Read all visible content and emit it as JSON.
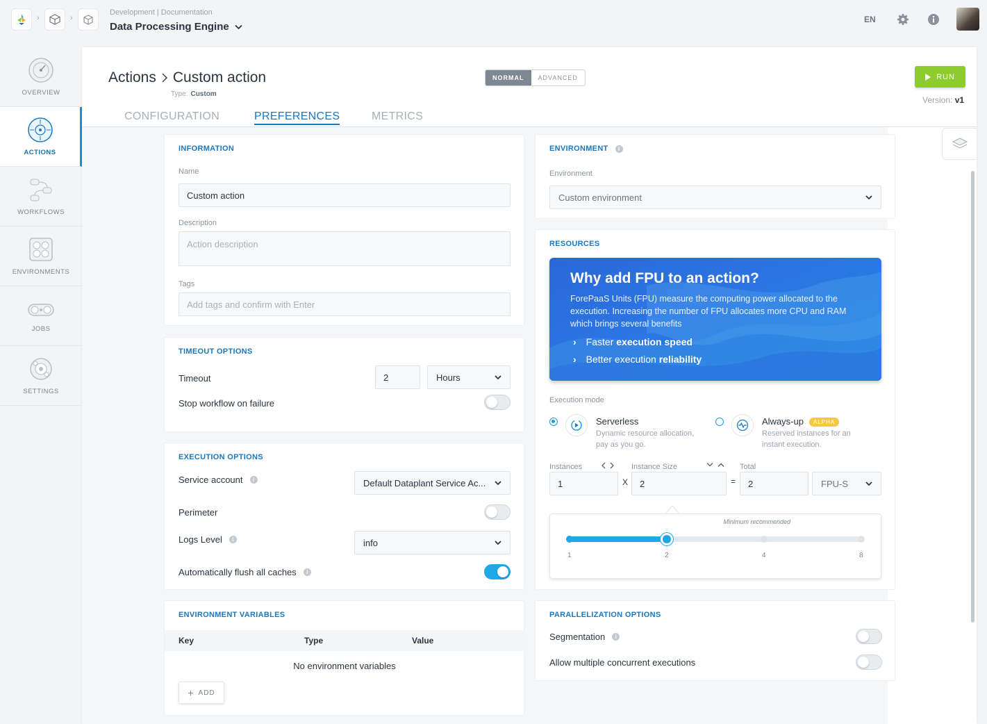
{
  "header": {
    "breadcrumb_small": "Development | Documentation",
    "project_title": "Data Processing Engine",
    "language": "EN"
  },
  "sidebar": {
    "items": [
      {
        "label": "OVERVIEW",
        "icon": "gauge-icon"
      },
      {
        "label": "ACTIONS",
        "icon": "target-icon",
        "active": true
      },
      {
        "label": "WORKFLOWS",
        "icon": "workflow-icon"
      },
      {
        "label": "ENVIRONMENTS",
        "icon": "environment-icon"
      },
      {
        "label": "JOBS",
        "icon": "jobs-icon"
      },
      {
        "label": "SETTINGS",
        "icon": "gear-icon"
      }
    ]
  },
  "page": {
    "title_parent": "Actions",
    "title_current": "Custom action",
    "type_label": "Type:",
    "type_value": "Custom",
    "mode_normal": "NORMAL",
    "mode_advanced": "ADVANCED",
    "run_label": "RUN",
    "version_label": "Version:",
    "version_value": "v1",
    "tabs": [
      "CONFIGURATION",
      "PREFERENCES",
      "METRICS"
    ],
    "active_tab": "PREFERENCES"
  },
  "information": {
    "title": "INFORMATION",
    "name_label": "Name",
    "name_value": "Custom action",
    "description_label": "Description",
    "description_placeholder": "Action description",
    "tags_label": "Tags",
    "tags_placeholder": "Add tags and confirm with Enter"
  },
  "timeout": {
    "title": "TIMEOUT OPTIONS",
    "timeout_label": "Timeout",
    "timeout_value": "2",
    "unit": "Hours",
    "stop_label": "Stop workflow on failure",
    "stop_on": false
  },
  "execution": {
    "title": "EXECUTION OPTIONS",
    "service_account_label": "Service account",
    "service_account_value": "Default Dataplant Service Ac...",
    "perimeter_label": "Perimeter",
    "perimeter_on": false,
    "logs_label": "Logs Level",
    "logs_value": "info",
    "flush_label": "Automatically flush all caches",
    "flush_on": true
  },
  "env_vars": {
    "title": "ENVIRONMENT VARIABLES",
    "columns": [
      "Key",
      "Type",
      "Value"
    ],
    "empty_text": "No environment variables",
    "add_label": "ADD"
  },
  "environment": {
    "title": "ENVIRONMENT",
    "label": "Environment",
    "value": "Custom environment"
  },
  "resources": {
    "title": "RESOURCES",
    "banner_title": "Why add FPU to an action?",
    "banner_text": "ForePaaS Units (FPU) measure the computing power allocated to the execution. Increasing the number of FPU allocates more CPU and RAM which brings several benefits",
    "bullet1_prefix": "Faster",
    "bullet1_bold": "execution speed",
    "bullet2_prefix": "Better execution",
    "bullet2_bold": "reliability",
    "execution_mode_label": "Execution mode",
    "serverless_title": "Serverless",
    "serverless_desc": "Dynamic resource allocation, pay as you go.",
    "alwaysup_title": "Always-up",
    "alwaysup_badge": "ALPHA",
    "alwaysup_desc": "Reserved instances for an instant execution.",
    "instances_label": "Instances",
    "instances_value": "1",
    "times": "X",
    "instance_size_label": "Instance Size",
    "instance_size_value": "2",
    "equals": "=",
    "total_label": "Total",
    "total_value": "2",
    "unit": "FPU-S",
    "min_recommended": "Minimum recommended",
    "slider_ticks": [
      "1",
      "2",
      "4",
      "8"
    ],
    "slider_value": 2,
    "selected_mode": "Serverless"
  },
  "parallelization": {
    "title": "PARALLELIZATION OPTIONS",
    "segmentation_label": "Segmentation",
    "segmentation_on": false,
    "concurrent_label": "Allow multiple concurrent executions",
    "concurrent_on": false
  },
  "colors": {
    "accent": "#1b77bd",
    "run": "#8ccc2f",
    "toggle_on": "#1fa8e6",
    "alpha_badge": "#f6c842"
  }
}
